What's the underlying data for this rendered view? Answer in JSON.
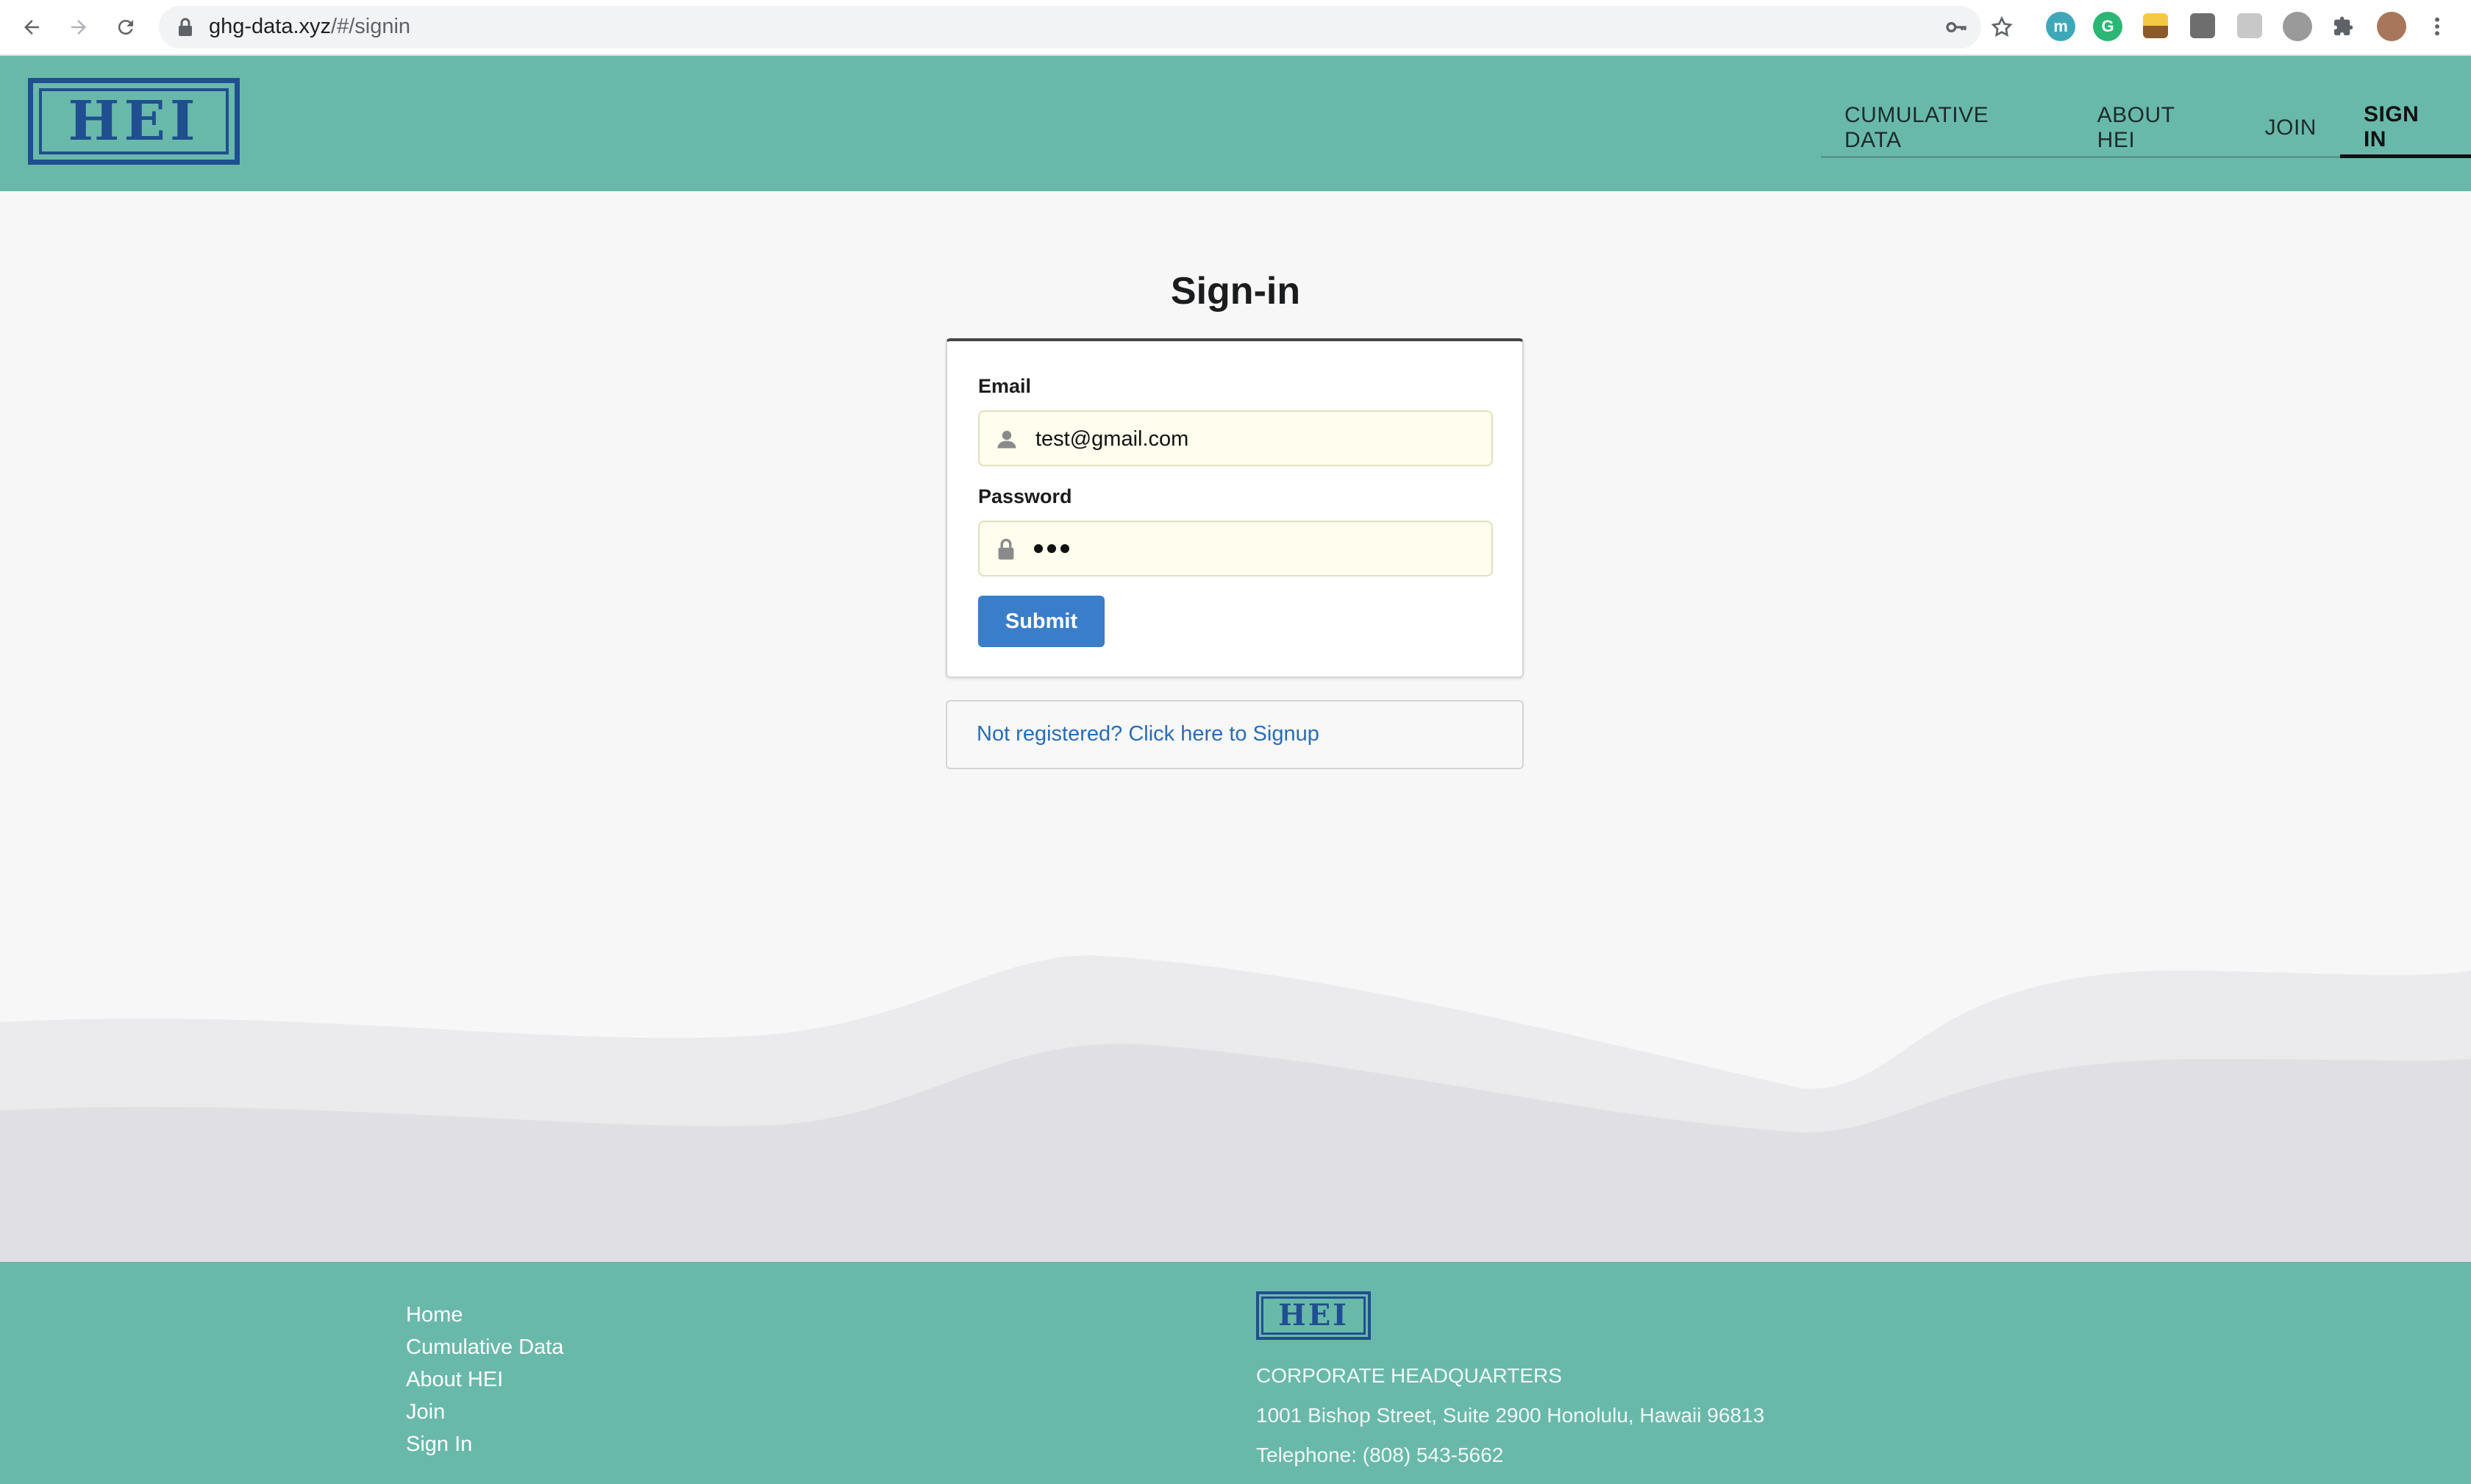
{
  "browser": {
    "url_host": "ghg-data.xyz",
    "url_path": "/#/signin"
  },
  "header": {
    "logo_text": "HEI",
    "nav": [
      {
        "label": "CUMULATIVE DATA",
        "active": false
      },
      {
        "label": "ABOUT HEI",
        "active": false
      },
      {
        "label": "JOIN",
        "active": false
      },
      {
        "label": "SIGN IN",
        "active": true
      }
    ]
  },
  "signin": {
    "title": "Sign-in",
    "email_label": "Email",
    "email_value": "test@gmail.com",
    "password_label": "Password",
    "password_length": 3,
    "submit_label": "Submit",
    "signup_link": "Not registered? Click here to Signup"
  },
  "footer": {
    "links": [
      "Home",
      "Cumulative Data",
      "About HEI",
      "Join",
      "Sign In"
    ],
    "logo_text": "HEI",
    "hq_title": "CORPORATE HEADQUARTERS",
    "address": "1001 Bishop Street, Suite 2900 Honolulu, Hawaii 96813",
    "telephone": "Telephone: (808) 543-5662"
  },
  "colors": {
    "header_bg": "#69b9aa",
    "logo_blue": "#1f4f90",
    "submit_bg": "#3a7dc9",
    "link_blue": "#2a6cb5",
    "input_bg": "#fffdee"
  }
}
